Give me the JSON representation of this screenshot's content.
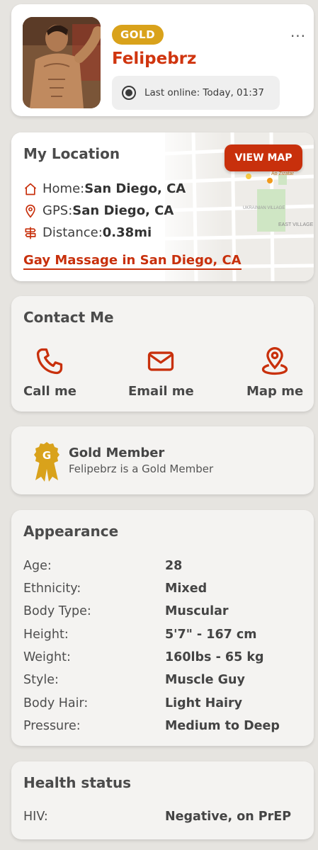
{
  "profile": {
    "badge": "GOLD",
    "username": "Felipebrz",
    "last_online": "Last online: Today, 01:37",
    "more_menu": "..."
  },
  "location": {
    "title": "My Location",
    "view_map_label": "VIEW MAP",
    "home_label": "Home: ",
    "home_value": "San Diego, CA",
    "gps_label": "GPS: ",
    "gps_value": "San Diego, CA",
    "distance_label": "Distance: ",
    "distance_value": "0.38mi",
    "link_text": "Gay Massage in San Diego, CA",
    "map_labels": [
      "Ao Zizatar",
      "UKRAINIAN VILLAGE",
      "EAST VILLAGE"
    ]
  },
  "contact": {
    "title": "Contact Me",
    "call_label": "Call me",
    "email_label": "Email me",
    "map_label": "Map me"
  },
  "gold_member": {
    "medal_letter": "G",
    "title": "Gold Member",
    "subtitle": "Felipebrz is a Gold Member"
  },
  "appearance": {
    "title": "Appearance",
    "rows": [
      {
        "key": "Age:",
        "value": "28"
      },
      {
        "key": "Ethnicity:",
        "value": "Mixed"
      },
      {
        "key": "Body Type:",
        "value": "Muscular"
      },
      {
        "key": "Height:",
        "value": "5'7\" - 167 cm"
      },
      {
        "key": "Weight:",
        "value": "160lbs - 65 kg"
      },
      {
        "key": "Style:",
        "value": "Muscle Guy"
      },
      {
        "key": "Body Hair:",
        "value": "Light Hairy"
      },
      {
        "key": "Pressure:",
        "value": "Medium to Deep"
      }
    ]
  },
  "health": {
    "title": "Health status",
    "rows": [
      {
        "key": "HIV:",
        "value": "Negative, on PrEP"
      }
    ]
  },
  "colors": {
    "accent": "#c8300c",
    "gold": "#d9a21b",
    "background": "#e6e4e0",
    "card": "#f4f3f1"
  }
}
